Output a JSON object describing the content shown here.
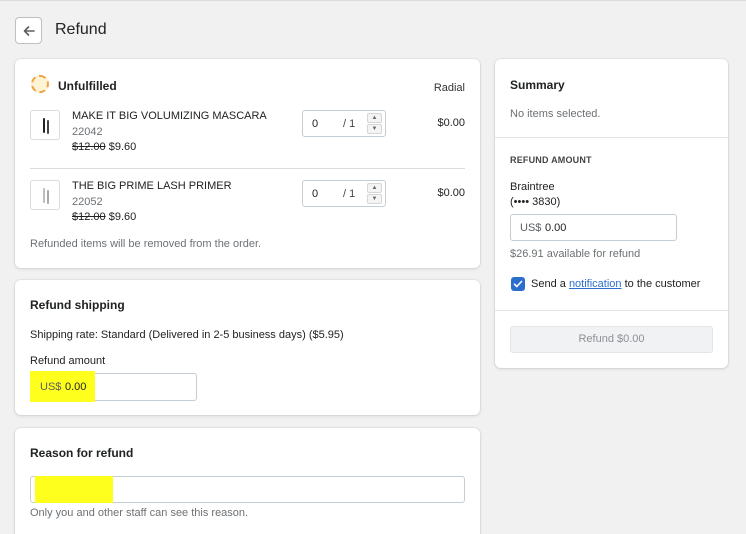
{
  "header": {
    "title": "Refund",
    "back_icon": "arrow-left-icon"
  },
  "unfulfilled": {
    "title": "Unfulfilled",
    "location": "Radial",
    "status_color": "#f0a640",
    "items": [
      {
        "name": "MAKE IT BIG VOLUMIZING MASCARA",
        "sku": "22042",
        "original_price": "$12.00",
        "sale_price": "$9.60",
        "qty_value": "0",
        "qty_max": "/ 1",
        "total": "$0.00"
      },
      {
        "name": "THE BIG PRIME LASH PRIMER",
        "sku": "22052",
        "original_price": "$12.00",
        "sale_price": "$9.60",
        "qty_value": "0",
        "qty_max": "/ 1",
        "total": "$0.00"
      }
    ],
    "note": "Refunded items will be removed from the order."
  },
  "shipping": {
    "title": "Refund shipping",
    "rate": "Shipping rate: Standard (Delivered in 2-5 business days) ($5.95)",
    "amount_label": "Refund amount",
    "currency": "US$",
    "amount": "0.00"
  },
  "reason": {
    "title": "Reason for refund",
    "value": "",
    "note": "Only you and other staff can see this reason."
  },
  "summary": {
    "title": "Summary",
    "empty_text": "No items selected.",
    "refund_amount_heading": "REFUND AMOUNT",
    "gateway": "Braintree",
    "card": "(•••• 3830)",
    "currency": "US$",
    "amount": "0.00",
    "available": "$26.91 available for refund",
    "notify_prefix": "Send a",
    "notify_link": "notification",
    "notify_suffix": "to the customer",
    "notify_checked": true,
    "refund_button": "Refund $0.00"
  },
  "colors": {
    "accent": "#2c6ecb",
    "highlight": "#ffff1e"
  }
}
